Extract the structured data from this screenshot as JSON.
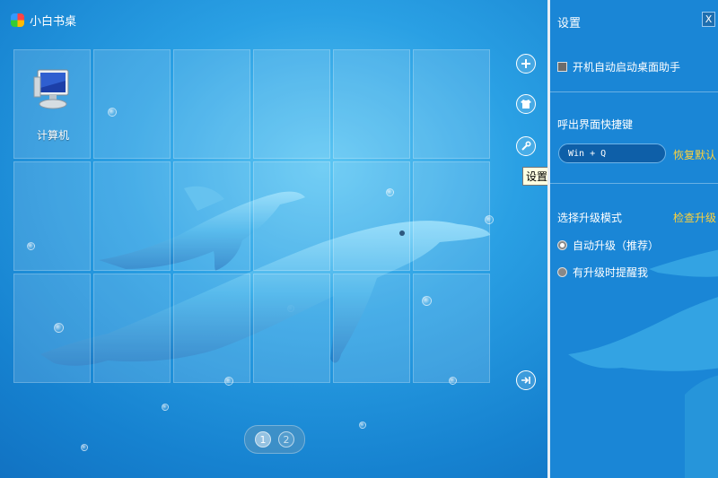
{
  "app": {
    "title": "小白书桌"
  },
  "desktop": {
    "icons": [
      {
        "label": "计算机",
        "icon": "computer-icon"
      }
    ]
  },
  "side_buttons": [
    {
      "name": "add",
      "icon": "plus-icon"
    },
    {
      "name": "skin",
      "icon": "shirt-icon"
    },
    {
      "name": "settings",
      "icon": "wrench-icon"
    },
    {
      "name": "exit",
      "icon": "exit-icon"
    }
  ],
  "tooltip": {
    "text": "设置"
  },
  "pager": {
    "pages": [
      "1",
      "2"
    ],
    "current": "1"
  },
  "settings_panel": {
    "title": "设置",
    "close_label": "X",
    "autostart": {
      "label": "开机自动启动桌面助手",
      "checked": false
    },
    "hotkey_section": {
      "label": "呼出界面快捷键",
      "value": "Win + Q",
      "reset_label": "恢复默认"
    },
    "upgrade_section": {
      "label": "选择升级模式",
      "check_label": "检查升级",
      "options": [
        {
          "label": "自动升级（推荐）",
          "selected": true
        },
        {
          "label": "有升级时提醒我",
          "selected": false
        }
      ]
    }
  },
  "colors": {
    "background": "#2aa0e4",
    "panel": "#1a86d6",
    "link": "#ffd23a"
  }
}
